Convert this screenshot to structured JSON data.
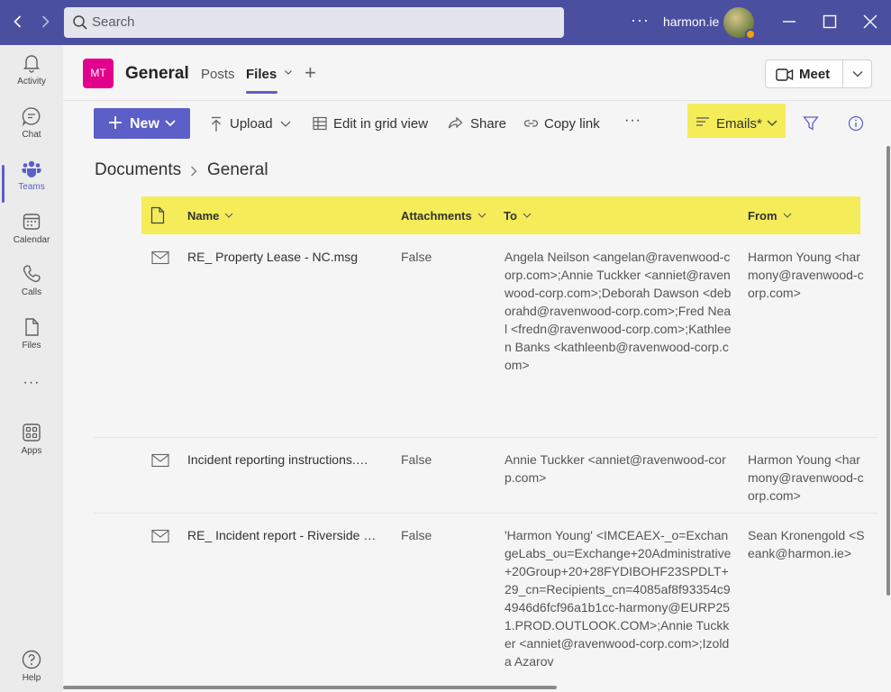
{
  "titlebar": {
    "search_placeholder": "Search",
    "more": "···",
    "org_name": "harmon.ie"
  },
  "rail": {
    "items": [
      {
        "label": "Activity",
        "icon": "bell-icon"
      },
      {
        "label": "Chat",
        "icon": "chat-icon"
      },
      {
        "label": "Teams",
        "icon": "teams-icon",
        "active": true
      },
      {
        "label": "Calendar",
        "icon": "calendar-icon"
      },
      {
        "label": "Calls",
        "icon": "phone-icon"
      },
      {
        "label": "Files",
        "icon": "file-icon"
      },
      {
        "label": "···",
        "icon": "more-icon"
      },
      {
        "label": "Apps",
        "icon": "apps-icon"
      },
      {
        "label": "Help",
        "icon": "help-icon"
      }
    ]
  },
  "channel": {
    "team_initials": "MT",
    "name": "General",
    "tabs": [
      {
        "label": "Posts"
      },
      {
        "label": "Files",
        "active": true
      }
    ],
    "add_tab": "+",
    "meet_label": "Meet"
  },
  "commands": {
    "new_label": "New",
    "upload_label": "Upload",
    "grid_label": "Edit in grid view",
    "share_label": "Share",
    "copy_label": "Copy link",
    "more": "···",
    "view_label": "Emails*"
  },
  "breadcrumb": {
    "root": "Documents",
    "current": "General"
  },
  "table": {
    "columns": [
      "Name",
      "Attachments",
      "To",
      "From"
    ],
    "rows": [
      {
        "name": "RE_ Property Lease - NC.msg",
        "attachments": "False",
        "to": "Angela Neilson <angelan@ravenwood-corp.com>;Annie Tuckker <anniet@ravenwood-corp.com>;Deborah Dawson <deborahd@ravenwood-corp.com>;Fred Neal <fredn@ravenwood-corp.com>;Kathleen Banks <kathleenb@ravenwood-corp.com>",
        "from": "Harmon Young <harmony@ravenwood-corp.com>"
      },
      {
        "name": "Incident reporting instructions.msg",
        "attachments": "False",
        "to": "Annie Tuckker <anniet@ravenwood-corp.com>",
        "from": "Harmon Young <harmony@ravenwood-corp.com>"
      },
      {
        "name": "RE_ Incident report - Riverside .msg",
        "attachments": "False",
        "to": "'Harmon Young' <IMCEAEX-_o=ExchangeLabs_ou=Exchange+20Administrative+20Group+20+28FYDIBOHF23SPDLT+29_cn=Recipients_cn=4085af8f93354c94946d6fcf96a1b1cc-harmony@EURP251.PROD.OUTLOOK.COM>;Annie Tuckker <anniet@ravenwood-corp.com>;Izolda Azarov",
        "from": "Sean Kronengold <Seank@harmon.ie>"
      }
    ]
  }
}
